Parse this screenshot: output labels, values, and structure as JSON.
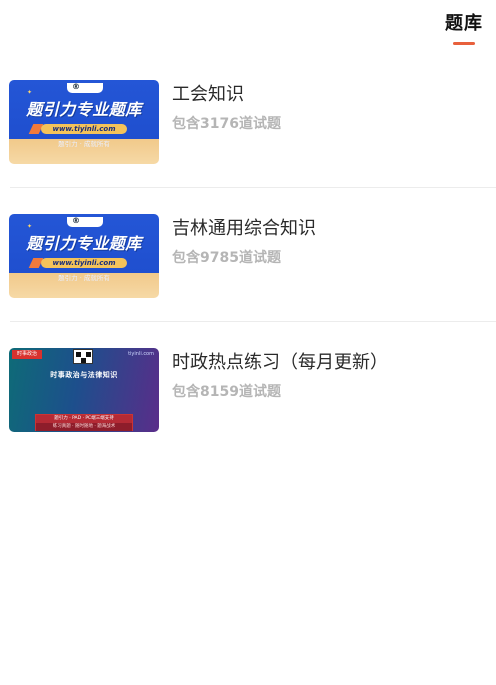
{
  "header": {
    "tab_label": "题库"
  },
  "items": [
    {
      "title": "工会知识",
      "count": "包含3176道试题",
      "thumbnail": {
        "style": "blue",
        "headline": "题引力专业题库",
        "url": "www.tiyinli.com",
        "tag": "题引力 · 成就所有"
      }
    },
    {
      "title": "吉林通用综合知识",
      "count": "包含9785道试题",
      "thumbnail": {
        "style": "blue",
        "headline": "题引力专业题库",
        "url": "www.tiyinli.com",
        "tag": "题引力 · 成就所有"
      }
    },
    {
      "title": "时政热点练习（每月更新）",
      "count": "包含8159道试题",
      "thumbnail": {
        "style": "dark",
        "corner_label": "时事政治",
        "site": "tiyinli.com",
        "headline": "时事政治与法律知识",
        "box_top": "题引力 · PAD · PC端三端支持",
        "box_bottom": "练习真题 · 随时随地 · 题海战术"
      }
    }
  ],
  "colors": {
    "accent": "#e8603c",
    "title": "#2a2a2a",
    "count": "#b5b5b5",
    "divider": "#ececec"
  }
}
